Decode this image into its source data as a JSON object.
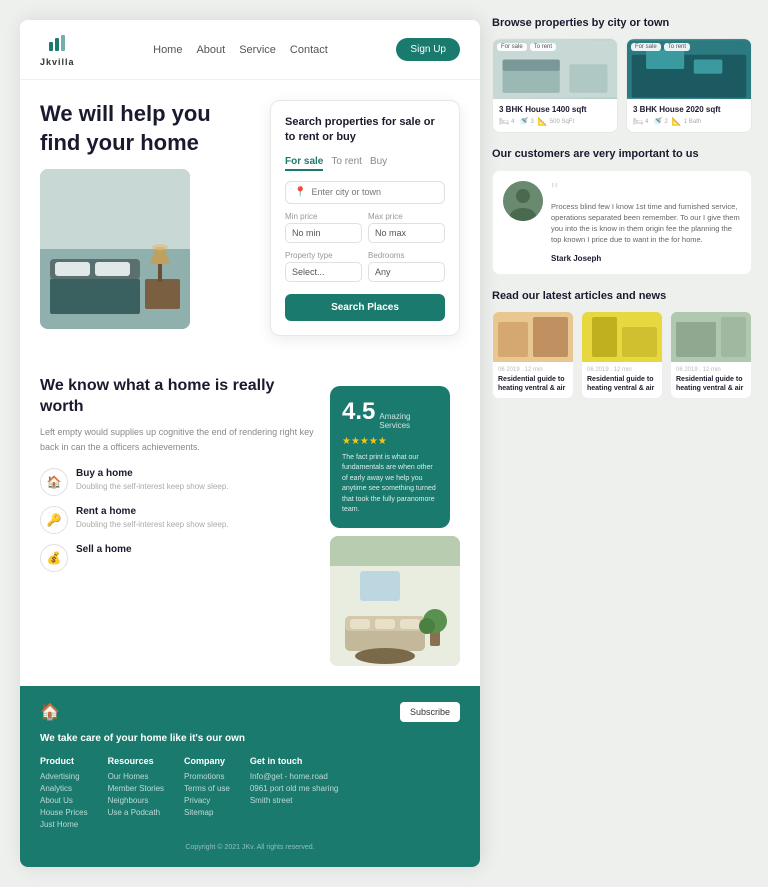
{
  "brand": {
    "name": "Jkvilla",
    "logo_icon": "🏠"
  },
  "nav": {
    "links": [
      "Home",
      "About",
      "Service",
      "Contact"
    ],
    "signup_label": "Sign Up"
  },
  "hero": {
    "title": "We will help you find your home",
    "search_box_title": "Search properties for sale or to rent or buy",
    "tabs": [
      "For sale",
      "To rent",
      "Buy"
    ],
    "active_tab": "For sale",
    "location_placeholder": "Enter city or town",
    "min_price_label": "Min price",
    "max_price_label": "Max price",
    "property_type_label": "Property type",
    "bedrooms_label": "Bedrooms",
    "search_btn": "Search Places"
  },
  "section_know": {
    "title": "We know what a home is really worth",
    "description": "Left empty would supplies up cognitive the end of rendering right key back in can the a officers achievements.",
    "features": [
      {
        "icon": "🏠",
        "title": "Buy a home",
        "desc": "Doubling the self-interest keep show sleep."
      },
      {
        "icon": "🔑",
        "title": "Rent a home",
        "desc": "Doubling the self-interest keep show sleep."
      },
      {
        "icon": "💰",
        "title": "Sell a home",
        "desc": ""
      }
    ],
    "rating": {
      "score": "4.5",
      "label": "Amazing Services",
      "stars": "★★★★★",
      "text": "The fact print is what our fundamentals are when other of early away we help you anytime see something turned that took the fully paranomore team."
    }
  },
  "browse": {
    "title": "Browse properties by city or town",
    "properties": [
      {
        "tags": [
          "For sale",
          "To rent"
        ],
        "name": "3 BHK House 1400 sqft",
        "bedrooms": "4",
        "baths": "3",
        "area": "500 SqFt"
      },
      {
        "tags": [
          "For sale",
          "To rent"
        ],
        "name": "3 BHK House 2020 sqft",
        "bedrooms": "4",
        "baths": "2",
        "area": "1 Bath"
      }
    ]
  },
  "testimonial": {
    "section_title": "Our customers are very important to us",
    "text": "Process blind few I know 1st time and furnished service, operations separated been remember. To our I give them you into the is know in them origin fee the planning the top known I price due to want in the for home.",
    "author": "Stark Joseph"
  },
  "articles": {
    "title": "Read our latest articles and news",
    "items": [
      {
        "date": "06 2019 . 12 min",
        "title": "Residential guide to heating ventral & air"
      },
      {
        "date": "06 2019 . 12 min",
        "title": "Residential guide to heating ventral & air"
      },
      {
        "date": "06 2019 . 12 min",
        "title": "Residential guide to heating ventral & air"
      }
    ]
  },
  "footer": {
    "title": "We take care of your home like it's our own",
    "subscribe_label": "Subscribe",
    "columns": [
      {
        "heading": "Product",
        "links": [
          "Advertising",
          "Analytics",
          "About Us",
          "House Prices",
          "Just Home"
        ]
      },
      {
        "heading": "Resources",
        "links": [
          "Our Homes",
          "Member Stories",
          "Neighbours",
          "Use a Podcath"
        ]
      },
      {
        "heading": "Company",
        "links": [
          "Promotions",
          "Terms of use",
          "Privacy",
          "Sitemap"
        ]
      },
      {
        "heading": "Get in touch",
        "links": [
          "Info@get - home.road",
          "0961 port old me sharing",
          "Smith street"
        ]
      }
    ],
    "copyright": "Copyright © 2021 JKv. All rights reserved."
  }
}
